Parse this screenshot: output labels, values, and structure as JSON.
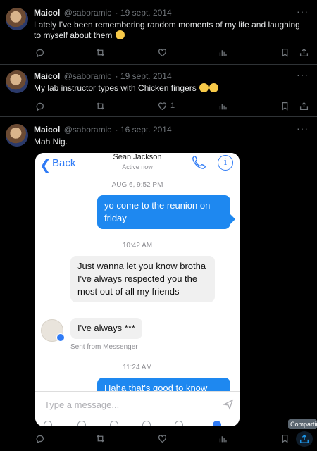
{
  "tweets": [
    {
      "name": "Maicol",
      "handle": "@saboramic",
      "date": "· 19 sept. 2014",
      "text": "Lately I've been remembering random moments of my life and laughing to myself about them",
      "emoji": "grinning-sweat-face",
      "likes": ""
    },
    {
      "name": "Maicol",
      "handle": "@saboramic",
      "date": "· 19 sept. 2014",
      "text": "My lab instructor types with Chicken fingers",
      "emoji": "laughing-faces",
      "likes": "1"
    },
    {
      "name": "Maicol",
      "handle": "@saboramic",
      "date": "· 16 sept. 2014",
      "text": "Mah Nig.",
      "likes": ""
    }
  ],
  "more_glyph": "···",
  "screenshot": {
    "back_label": "Back",
    "contact_name": "Sean Jackson",
    "contact_status": "Active now",
    "timestamp1": "AUG 6, 9:52 PM",
    "msg1": "yo come to the reunion on friday",
    "timestamp2": "10:42 AM",
    "msg2": "Just wanna let you know brotha I've always respected you the most out of all my friends",
    "msg3": "I've always ***",
    "sent_from": "Sent from Messenger",
    "timestamp3": "11:24 AM",
    "msg4": "Haha that's good to know",
    "placeholder": "Type a message..."
  },
  "tooltip": "Compartir",
  "colors": {
    "background": "#000000",
    "muted": "#71767b",
    "messenger_blue": "#1e88f0"
  }
}
